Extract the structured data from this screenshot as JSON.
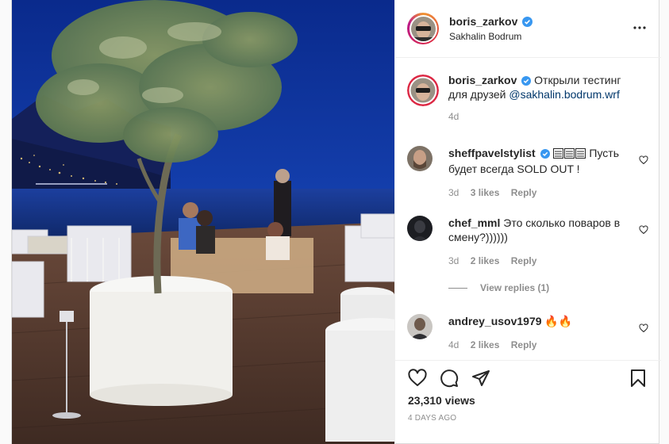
{
  "post": {
    "author": "boris_zarkov",
    "location": "Sakhalin Bodrum",
    "caption": {
      "username": "boris_zarkov",
      "text": "Открыли тестинг для друзей",
      "mention": "@sakhalin.bodrum.wrf",
      "time": "4d"
    }
  },
  "comments": [
    {
      "username": "sheffpavelstylist",
      "text": "Пусть будет всегда SOLD OUT !",
      "time": "3d",
      "likes": "3 likes",
      "reply": "Reply"
    },
    {
      "username": "chef_mml",
      "text": "Это сколько поваров в смену?))))))",
      "time": "3d",
      "likes": "2 likes",
      "reply": "Reply"
    },
    {
      "username": "andrey_usov1979",
      "text": "🔥🔥",
      "time": "4d",
      "likes": "2 likes",
      "reply": "Reply"
    }
  ],
  "view_replies": "View replies (1)",
  "stats": {
    "views": "23,310 views",
    "posted": "4 DAYS AGO"
  },
  "icons": {
    "verified": "verified-badge-icon",
    "more": "more-options-icon",
    "like": "heart-icon",
    "comment": "comment-icon",
    "share": "paper-plane-icon",
    "save": "bookmark-icon",
    "comment_like": "small-heart-icon"
  },
  "colors": {
    "verified_blue": "#3897f0",
    "mention": "#00376b",
    "muted": "#8e8e8e",
    "text": "#262626"
  }
}
